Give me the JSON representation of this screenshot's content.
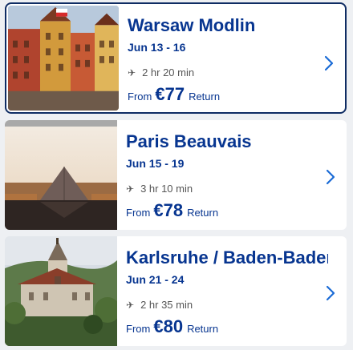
{
  "flights": [
    {
      "destination": "Warsaw Modlin",
      "dates": "Jun 13 - 16",
      "duration": "2 hr 20 min",
      "from_label": "From",
      "price": "€77",
      "trip_type": "Return",
      "image": "warsaw-old-town-photo",
      "selected": true
    },
    {
      "destination": "Paris Beauvais",
      "dates": "Jun 15 - 19",
      "duration": "3 hr 10 min",
      "from_label": "From",
      "price": "€78",
      "trip_type": "Return",
      "image": "louvre-pyramid-photo",
      "selected": false
    },
    {
      "destination": "Karlsruhe / Baden-Baden",
      "dates": "Jun 21 - 24",
      "duration": "2 hr 35 min",
      "from_label": "From",
      "price": "€80",
      "trip_type": "Return",
      "image": "baden-baden-church-photo",
      "selected": false
    }
  ],
  "icons": {
    "duration": "plane-icon",
    "chevron": "chevron-right-icon"
  },
  "colors": {
    "brand_blue": "#073590",
    "selected_border": "#0f2c63",
    "chevron_blue": "#1a6bd6"
  }
}
